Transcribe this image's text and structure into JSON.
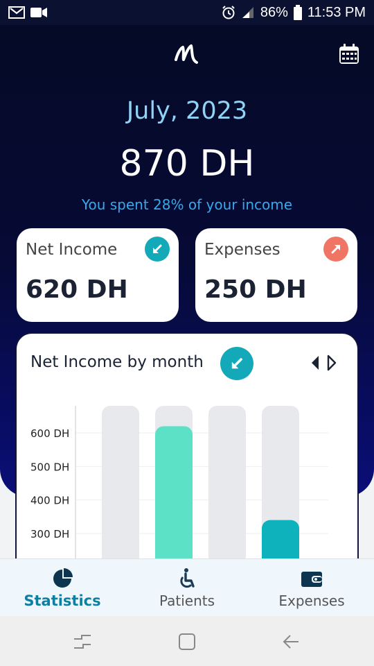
{
  "status_bar": {
    "battery": "86%",
    "time": "11:53 PM",
    "icons": [
      "gmail-icon",
      "video-icon",
      "alarm-icon",
      "signal-icon",
      "battery-icon"
    ]
  },
  "header": {
    "logo": "app-logo",
    "calendar_icon": "calendar-icon"
  },
  "summary": {
    "month": "July, 2023",
    "balance": "870 DH",
    "spent_text": "You spent 28% of your income"
  },
  "cards": {
    "income": {
      "title": "Net Income",
      "amount": "620 DH",
      "icon": "arrow-down-left-icon"
    },
    "expenses": {
      "title": "Expenses",
      "amount": "250 DH",
      "icon": "arrow-up-right-icon"
    }
  },
  "chart_panel": {
    "title": "Net Income by month",
    "icon": "arrow-down-left-icon",
    "nav_icon": "prev-next-icon"
  },
  "chart_data": {
    "type": "bar",
    "title": "Net Income by month",
    "series": [
      {
        "values": [
          null,
          620,
          null,
          340
        ]
      }
    ],
    "background_bars": 4,
    "yticks": [
      "600 DH",
      "500 DH",
      "400 DH",
      "300 DH"
    ],
    "ytick_values": [
      600,
      500,
      400,
      300
    ],
    "bar_colors": [
      "#e8e9ec",
      "#5ce1c6",
      "#e8e9ec",
      "#0eb2bd"
    ],
    "grid": true
  },
  "tabs": [
    {
      "label": "Statistics",
      "icon": "pie-chart-icon",
      "active": true
    },
    {
      "label": "Patients",
      "icon": "wheelchair-icon",
      "active": false
    },
    {
      "label": "Expenses",
      "icon": "wallet-icon",
      "active": false
    }
  ],
  "system_nav": [
    "recents-icon",
    "home-icon",
    "back-icon"
  ],
  "colors": {
    "header_bg": "#050a26",
    "accent_teal": "#13a9b8",
    "accent_coral": "#f07564",
    "month_text": "#8fd4f6",
    "spent_text": "#38a8ea",
    "active_tab": "#0e7fa1"
  }
}
